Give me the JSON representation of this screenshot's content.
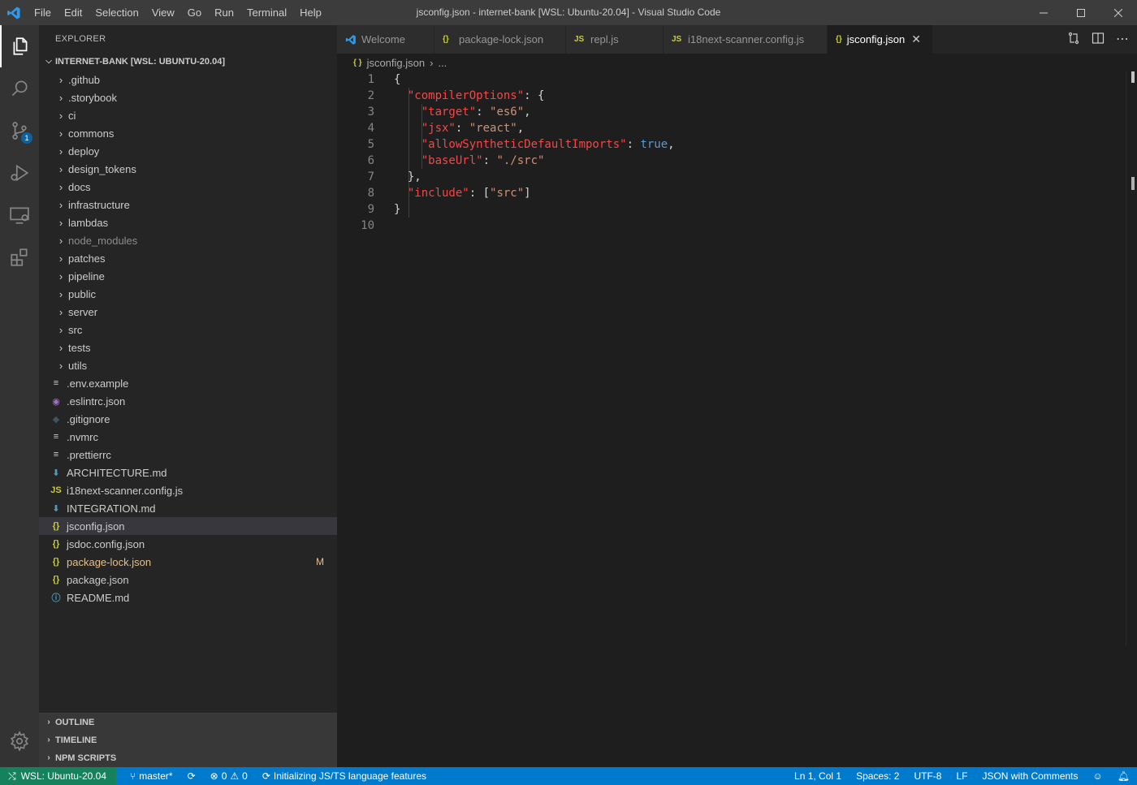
{
  "window": {
    "title": "jsconfig.json - internet-bank [WSL: Ubuntu-20.04] - Visual Studio Code",
    "menu": [
      "File",
      "Edit",
      "Selection",
      "View",
      "Go",
      "Run",
      "Terminal",
      "Help"
    ],
    "controls": [
      "minimize",
      "maximize",
      "close"
    ]
  },
  "activitybar": {
    "items": [
      {
        "name": "explorer",
        "icon": "files-icon",
        "active": true
      },
      {
        "name": "search",
        "icon": "search-icon"
      },
      {
        "name": "source-control",
        "icon": "source-control-icon",
        "badge": "1"
      },
      {
        "name": "run-debug",
        "icon": "run-debug-icon"
      },
      {
        "name": "remote-explorer",
        "icon": "remote-explorer-icon"
      },
      {
        "name": "extensions",
        "icon": "extensions-icon"
      }
    ],
    "settings_icon": "gear-icon"
  },
  "sidebar": {
    "title": "EXPLORER",
    "root": "INTERNET-BANK [WSL: UBUNTU-20.04]",
    "folders": [
      ".github",
      ".storybook",
      "ci",
      "commons",
      "deploy",
      "design_tokens",
      "docs",
      "infrastructure",
      "lambdas",
      "node_modules",
      "patches",
      "pipeline",
      "public",
      "server",
      "src",
      "tests",
      "utils"
    ],
    "files": [
      {
        "name": ".env.example",
        "icon": "≡",
        "color": "#cccccc"
      },
      {
        "name": ".eslintrc.json",
        "icon": "◉",
        "color": "#a074c4"
      },
      {
        "name": ".gitignore",
        "icon": "◆",
        "color": "#41535b"
      },
      {
        "name": ".nvmrc",
        "icon": "≡",
        "color": "#cccccc"
      },
      {
        "name": ".prettierrc",
        "icon": "≡",
        "color": "#cccccc"
      },
      {
        "name": "ARCHITECTURE.md",
        "icon": "⬇",
        "color": "#519aba"
      },
      {
        "name": "i18next-scanner.config.js",
        "icon": "JS",
        "color": "#cbcb41"
      },
      {
        "name": "INTEGRATION.md",
        "icon": "⬇",
        "color": "#519aba"
      },
      {
        "name": "jsconfig.json",
        "icon": "{}",
        "color": "#cbcb41",
        "active": true
      },
      {
        "name": "jsdoc.config.json",
        "icon": "{}",
        "color": "#cbcb41"
      },
      {
        "name": "package-lock.json",
        "icon": "{}",
        "color": "#cbcb41",
        "status": "M"
      },
      {
        "name": "package.json",
        "icon": "{}",
        "color": "#cbcb41"
      },
      {
        "name": "README.md",
        "icon": "ⓘ",
        "color": "#519aba"
      }
    ],
    "bottom_sections": [
      "OUTLINE",
      "TIMELINE",
      "NPM SCRIPTS"
    ]
  },
  "tabs": [
    {
      "label": "Welcome",
      "icon": "vscode-icon"
    },
    {
      "label": "package-lock.json",
      "icon": "{}"
    },
    {
      "label": "repl.js",
      "icon": "JS"
    },
    {
      "label": "i18next-scanner.config.js",
      "icon": "JS"
    },
    {
      "label": "jsconfig.json",
      "icon": "{}",
      "active": true
    }
  ],
  "breadcrumb": {
    "file": "jsconfig.json",
    "more": "..."
  },
  "editor": {
    "line_numbers": [
      "1",
      "2",
      "3",
      "4",
      "5",
      "6",
      "7",
      "8",
      "9",
      "10"
    ],
    "lines": [
      [
        {
          "t": "{",
          "c": "p"
        }
      ],
      [
        {
          "t": "  ",
          "c": "p"
        },
        {
          "t": "\"compilerOptions\"",
          "c": "k"
        },
        {
          "t": ": {",
          "c": "p"
        }
      ],
      [
        {
          "t": "    ",
          "c": "p"
        },
        {
          "t": "\"target\"",
          "c": "k"
        },
        {
          "t": ": ",
          "c": "p"
        },
        {
          "t": "\"es6\"",
          "c": "s"
        },
        {
          "t": ",",
          "c": "p"
        }
      ],
      [
        {
          "t": "    ",
          "c": "p"
        },
        {
          "t": "\"jsx\"",
          "c": "k"
        },
        {
          "t": ": ",
          "c": "p"
        },
        {
          "t": "\"react\"",
          "c": "s"
        },
        {
          "t": ",",
          "c": "p"
        }
      ],
      [
        {
          "t": "    ",
          "c": "p"
        },
        {
          "t": "\"allowSyntheticDefaultImports\"",
          "c": "k"
        },
        {
          "t": ": ",
          "c": "p"
        },
        {
          "t": "true",
          "c": "b"
        },
        {
          "t": ",",
          "c": "p"
        }
      ],
      [
        {
          "t": "    ",
          "c": "p"
        },
        {
          "t": "\"baseUrl\"",
          "c": "k"
        },
        {
          "t": ": ",
          "c": "p"
        },
        {
          "t": "\"./src\"",
          "c": "s"
        }
      ],
      [
        {
          "t": "  },",
          "c": "p"
        }
      ],
      [
        {
          "t": "  ",
          "c": "p"
        },
        {
          "t": "\"include\"",
          "c": "k"
        },
        {
          "t": ": [",
          "c": "p"
        },
        {
          "t": "\"src\"",
          "c": "s"
        },
        {
          "t": "]",
          "c": "p"
        }
      ],
      [
        {
          "t": "}",
          "c": "p"
        }
      ],
      []
    ]
  },
  "statusbar": {
    "remote": "WSL: Ubuntu-20.04",
    "branch": "master*",
    "errors": "0",
    "warnings": "0",
    "message": "Initializing JS/TS language features",
    "position": "Ln 1, Col 1",
    "spaces": "Spaces: 2",
    "encoding": "UTF-8",
    "eol": "LF",
    "language": "JSON with Comments"
  }
}
